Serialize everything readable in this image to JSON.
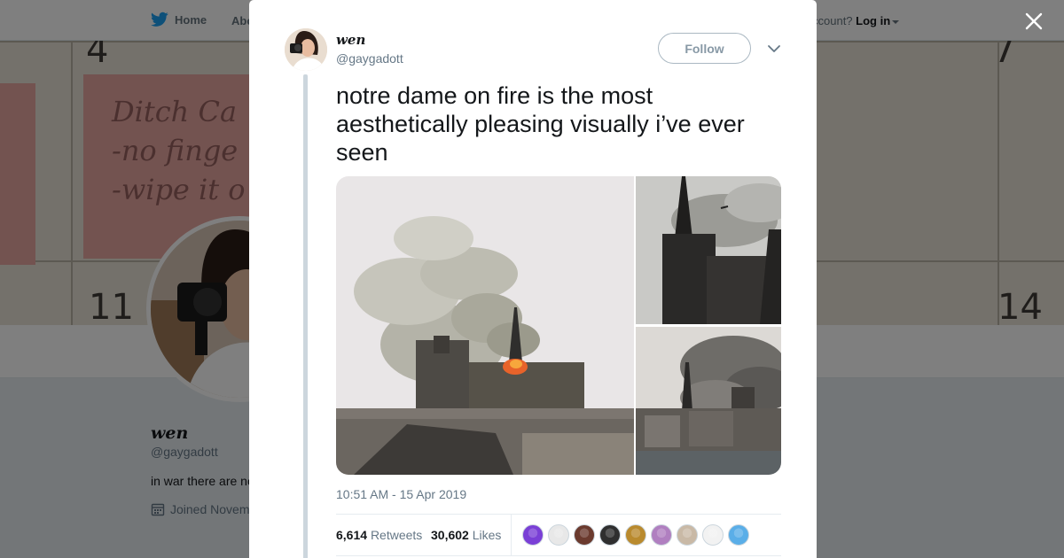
{
  "nav": {
    "home_label": "Home",
    "about_label": "Abo",
    "account_prompt": "ccount?",
    "login_label": "Log in"
  },
  "banner": {
    "dates": [
      "4",
      "7",
      "11",
      "14"
    ],
    "note_lines": [
      "Ditch Ca",
      "-no finge",
      "-wipe it o"
    ]
  },
  "profile": {
    "display_name": "wen",
    "handle": "@gaygadott",
    "bio": "in war there are no",
    "joined": "Joined Novem"
  },
  "tweet": {
    "display_name": "wen",
    "handle": "@gaygadott",
    "follow_label": "Follow",
    "text": "notre dame on fire is the most aesthetically pleasing visually i’ve ever seen",
    "timestamp": "10:51 AM - 15 Apr 2019",
    "retweets_count": "6,614",
    "retweets_label": "Retweets",
    "likes_count": "30,602",
    "likes_label": "Likes",
    "liker_colors": [
      "#7a3fd6",
      "#e8e8e8",
      "#6b3a2e",
      "#2f2f2f",
      "#b98a2e",
      "#b07fc0",
      "#c9b9a6",
      "#f2f2f2",
      "#5aaee8"
    ]
  },
  "colors": {
    "twitter_blue": "#1da1f2",
    "text_primary": "#14171a",
    "text_secondary": "#657786"
  }
}
